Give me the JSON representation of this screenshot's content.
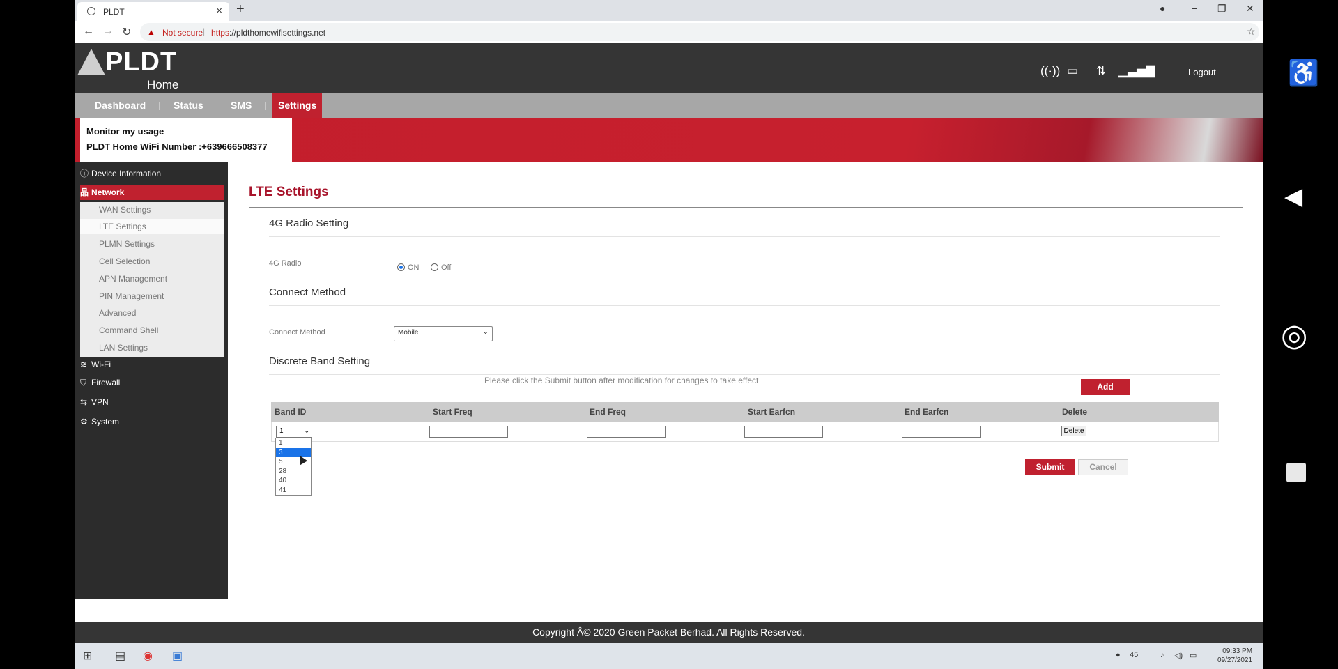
{
  "browser": {
    "tab_title": "PLDT",
    "url_scheme": "https",
    "url_rest": "://pldthomewifisettings.net",
    "security_label": "Not secure"
  },
  "header": {
    "logo_main": "PLDT",
    "logo_sub": "Home",
    "logout_label": "Logout"
  },
  "menu": {
    "items": [
      "Dashboard",
      "Status",
      "SMS",
      "Settings"
    ],
    "active": "Settings"
  },
  "banner": {
    "line1": "Monitor my usage",
    "line2": "PLDT Home WiFi Number :+639666508377"
  },
  "sidebar": {
    "device_info": "Device Information",
    "network": "Network",
    "submenu": [
      "WAN Settings",
      "LTE Settings",
      "PLMN Settings",
      "Cell Selection",
      "APN Management",
      "PIN Management",
      "Advanced",
      "Command Shell",
      "LAN Settings"
    ],
    "wifi": "Wi-Fi",
    "firewall": "Firewall",
    "vpn": "VPN",
    "system": "System"
  },
  "content": {
    "title": "LTE Settings",
    "radio_section": "4G Radio Setting",
    "radio_label": "4G Radio",
    "radio_on": "ON",
    "radio_off": "Off",
    "radio_value": "ON",
    "connect_section": "Connect Method",
    "connect_label": "Connect Method",
    "connect_value": "Mobile",
    "band_section": "Discrete Band Setting",
    "note": "Please click the Submit button after modification for changes to take effect",
    "add_label": "Add",
    "table_headers": [
      "Band ID",
      "Start Freq",
      "End Freq",
      "Start Earfcn",
      "End Earfcn",
      "Delete"
    ],
    "row_band_value": "1",
    "row_delete_label": "Delete",
    "band_options": [
      "1",
      "3",
      "5",
      "28",
      "40",
      "41"
    ],
    "band_highlighted": "3",
    "submit_label": "Submit",
    "cancel_label": "Cancel"
  },
  "footer": {
    "text": "Copyright Â© 2020 Green Packet Berhad. All Rights Reserved."
  },
  "taskbar": {
    "tray_number": "45",
    "time": "09:33 PM",
    "date": "09/27/2021"
  },
  "colors": {
    "brand_red": "#c0212f",
    "header_dark": "#353535",
    "menu_grey": "#a7a7a7"
  }
}
